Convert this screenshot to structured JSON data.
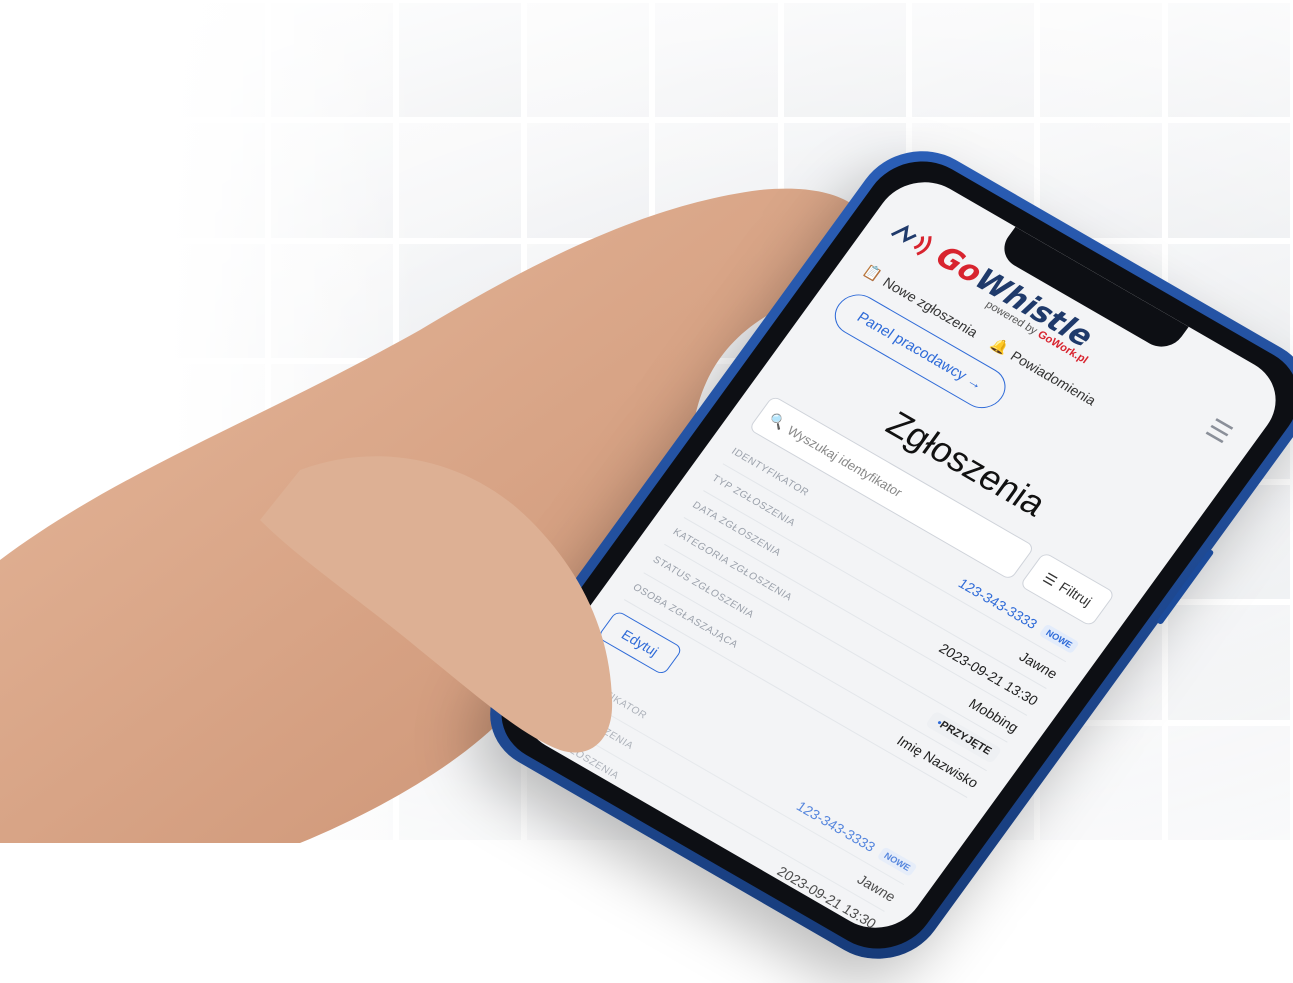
{
  "brand": {
    "logo_go": "Go",
    "logo_whistle": "Whistle",
    "powered_by_prefix": "powered by",
    "powered_by_brand": "GoWork.pl"
  },
  "nav": {
    "items": [
      {
        "label": "Nowe zgłoszenia",
        "icon": "clipboard-icon"
      },
      {
        "label": "Powiadomienia",
        "icon": "bell-icon"
      }
    ],
    "panel_button": "Panel pracodawcy →",
    "menu_icon": "hamburger-icon"
  },
  "page": {
    "title": "Zgłoszenia"
  },
  "search": {
    "placeholder": "Wyszukaj identyfikator",
    "filter_label": "Filtruj"
  },
  "records": [
    {
      "fields": [
        {
          "label": "IDENTYFIKATOR",
          "value": "123-343-3333",
          "badge": "NOWE"
        },
        {
          "label": "TYP ZGŁOSZENIA",
          "value": "Jawne"
        },
        {
          "label": "DATA ZGŁOSZENIA",
          "value": "2023-09-21 13:30"
        },
        {
          "label": "KATEGORIA ZGŁOSZENIA",
          "value": "Mobbing"
        },
        {
          "label": "STATUS ZGŁOSZENIA",
          "value": "PRZYJĘTE"
        },
        {
          "label": "OSOBA ZGŁASZAJĄCA",
          "value": "Imię Nazwisko"
        }
      ],
      "edit_label": "Edytuj"
    },
    {
      "fields": [
        {
          "label": "IDENTYFIKATOR",
          "value": "123-343-3333",
          "badge": "NOWE"
        },
        {
          "label": "TYP ZGŁOSZENIA",
          "value": "Jawne"
        },
        {
          "label": "DATA ZGŁOSZENIA",
          "value": "2023-09-21 13:30"
        }
      ]
    }
  ],
  "colors": {
    "accent": "#2f6bd8",
    "brand_red": "#d8242f",
    "brand_navy": "#1f3a6b",
    "phone_frame": "#1f4f9e"
  }
}
